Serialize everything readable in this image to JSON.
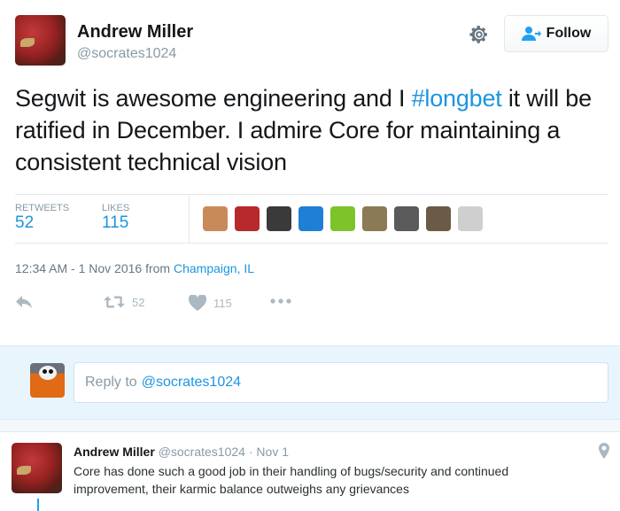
{
  "tweet": {
    "author_name": "Andrew Miller",
    "author_handle": "@socrates1024",
    "follow_label": "Follow",
    "text_before": "Segwit is awesome engineering and I ",
    "hashtag": "#longbet",
    "text_after": " it will be ratified in December. I admire Core for maintaining a consistent technical vision",
    "stats": {
      "retweets_label": "RETWEETS",
      "retweets": "52",
      "likes_label": "LIKES",
      "likes": "115"
    },
    "likers": [
      {
        "name": "liker-1",
        "color": "#c98a5a"
      },
      {
        "name": "liker-2",
        "color": "#b8292e"
      },
      {
        "name": "liker-3",
        "color": "#3a3a3a"
      },
      {
        "name": "liker-4-bitcoin",
        "color": "#1f7fd6"
      },
      {
        "name": "liker-5-lizard",
        "color": "#7cc42a"
      },
      {
        "name": "liker-6",
        "color": "#8a7a55"
      },
      {
        "name": "liker-7",
        "color": "#5a5a5a"
      },
      {
        "name": "liker-8",
        "color": "#6b5a45"
      },
      {
        "name": "liker-9",
        "color": "#cfcfcf"
      }
    ],
    "timestamp": "12:34 AM - 1 Nov 2016 from ",
    "location": "Champaign, IL",
    "actions": {
      "retweet_count": "52",
      "like_count": "115"
    }
  },
  "reply_box": {
    "placeholder_prefix": "Reply to",
    "placeholder_mention": "@socrates1024"
  },
  "reply_tweet": {
    "author_name": "Andrew Miller",
    "author_handle": "@socrates1024",
    "separator": "·",
    "date": "Nov 1",
    "text": "Core has done such a good job in their handling of bugs/security and continued improvement, their karmic balance outweighs any grievances"
  },
  "colors": {
    "accent": "#1b95e0",
    "muted": "#8899a6",
    "reply_bg": "#e8f5fd"
  }
}
